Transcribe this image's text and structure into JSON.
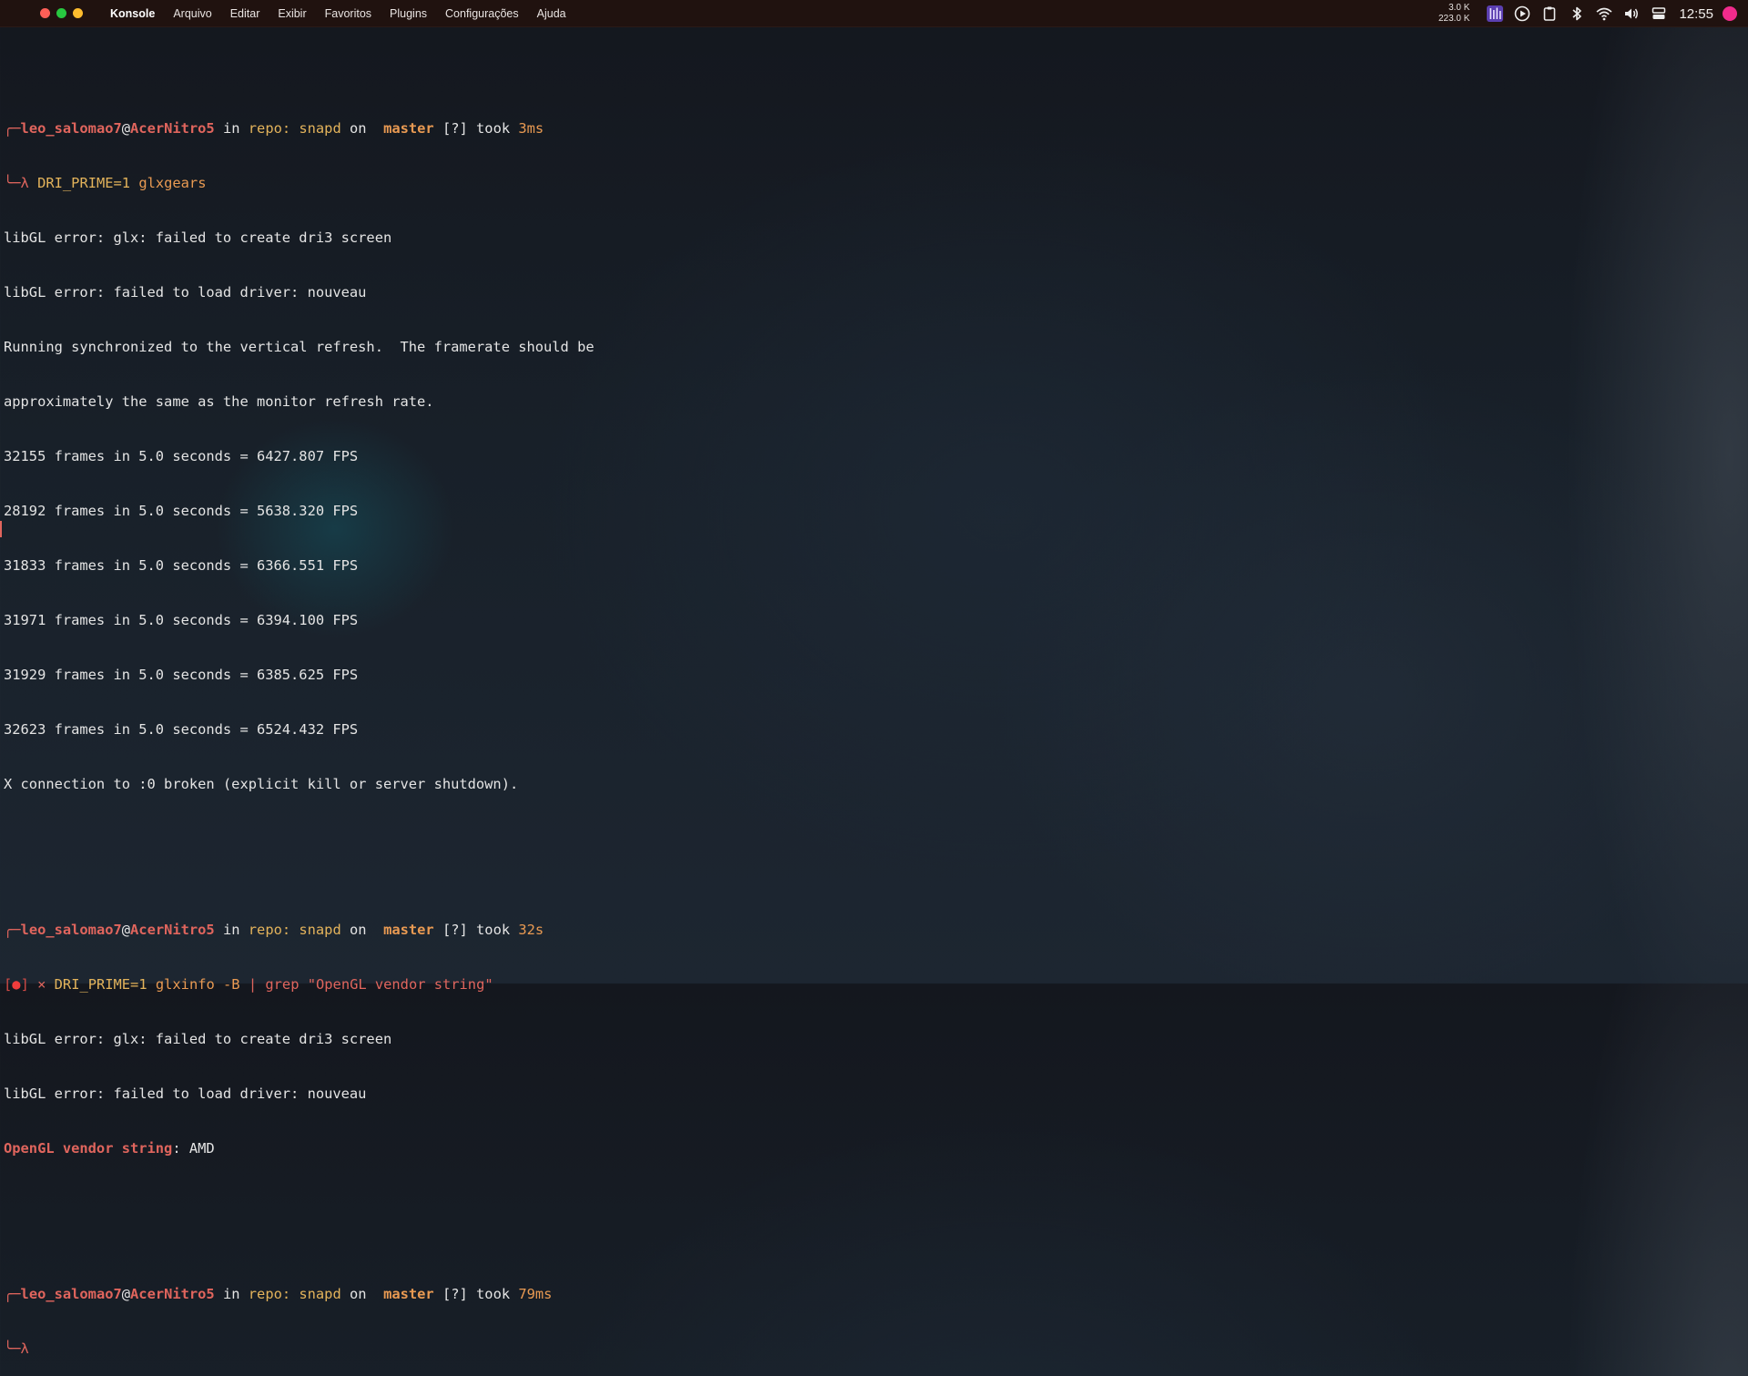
{
  "colors": {
    "prompt_red": "#e0655d",
    "orange": "#e99a52",
    "gold": "#e3b35b",
    "text": "#e4e4e4",
    "white": "#ffffff",
    "bracket": "#cf4a45",
    "error_badge": "#ef3c3c",
    "dot_close": "#ff5f57",
    "dot_min": "#28c840",
    "dot_max": "#febc2e",
    "user_dot": "#f02b8c"
  },
  "menubar": {
    "app_name": "Konsole",
    "items": [
      "Arquivo",
      "Editar",
      "Exibir",
      "Favoritos",
      "Plugins",
      "Configurações",
      "Ajuda"
    ]
  },
  "tray": {
    "net_up": "3.0 K",
    "net_down": "223.0 K",
    "time": "12:55",
    "icons": [
      "equalizer-icon",
      "play-icon",
      "clipboard-icon",
      "bluetooth-icon",
      "wifi-icon",
      "volume-icon",
      "storage-icon",
      "user-avatar-icon"
    ]
  },
  "terminal": {
    "prompt1": {
      "corner": "╭─",
      "user": "leo_salomao7",
      "at": "@",
      "host": "AcerNitro5",
      "in": " in ",
      "repo": "repo: snapd",
      "on": " on ",
      "branch_icon": "",
      "branch": "master",
      "status": " [?]",
      "took": " took ",
      "duration": "3ms"
    },
    "cmd1": {
      "corner": "╰─",
      "lambda": "λ",
      "env": "DRI_PRIME=1",
      "command": "glxgears"
    },
    "output1": [
      "libGL error: glx: failed to create dri3 screen",
      "libGL error: failed to load driver: nouveau",
      "Running synchronized to the vertical refresh.  The framerate should be",
      "approximately the same as the monitor refresh rate.",
      "32155 frames in 5.0 seconds = 6427.807 FPS",
      "28192 frames in 5.0 seconds = 5638.320 FPS",
      "31833 frames in 5.0 seconds = 6366.551 FPS",
      "31971 frames in 5.0 seconds = 6394.100 FPS",
      "31929 frames in 5.0 seconds = 6385.625 FPS",
      "32623 frames in 5.0 seconds = 6524.432 FPS",
      "X connection to :0 broken (explicit kill or server shutdown)."
    ],
    "prompt2": {
      "corner": "╭─",
      "user": "leo_salomao7",
      "at": "@",
      "host": "AcerNitro5",
      "in": " in ",
      "repo": "repo: snapd",
      "on": " on ",
      "branch_icon": "",
      "branch": "master",
      "status": " [?]",
      "took": " took ",
      "duration": "32s"
    },
    "cmd2": {
      "bracket_open": "[",
      "badge": "●",
      "bracket_close": "]",
      "cross": " × ",
      "env": "DRI_PRIME=1",
      "command": "glxinfo -B",
      "pipe": "|",
      "grep": "grep",
      "pattern": "\"OpenGL vendor string\""
    },
    "output2": [
      "libGL error: glx: failed to create dri3 screen",
      "libGL error: failed to load driver: nouveau"
    ],
    "vendor_line": {
      "key": "OpenGL vendor string",
      "sep": ": ",
      "value": "AMD"
    },
    "prompt3": {
      "corner": "╭─",
      "user": "leo_salomao7",
      "at": "@",
      "host": "AcerNitro5",
      "in": " in ",
      "repo": "repo: snapd",
      "on": " on ",
      "branch_icon": "",
      "branch": "master",
      "status": " [?]",
      "took": " took ",
      "duration": "79ms"
    },
    "cmd3": {
      "corner": "╰─",
      "lambda": "λ"
    }
  }
}
